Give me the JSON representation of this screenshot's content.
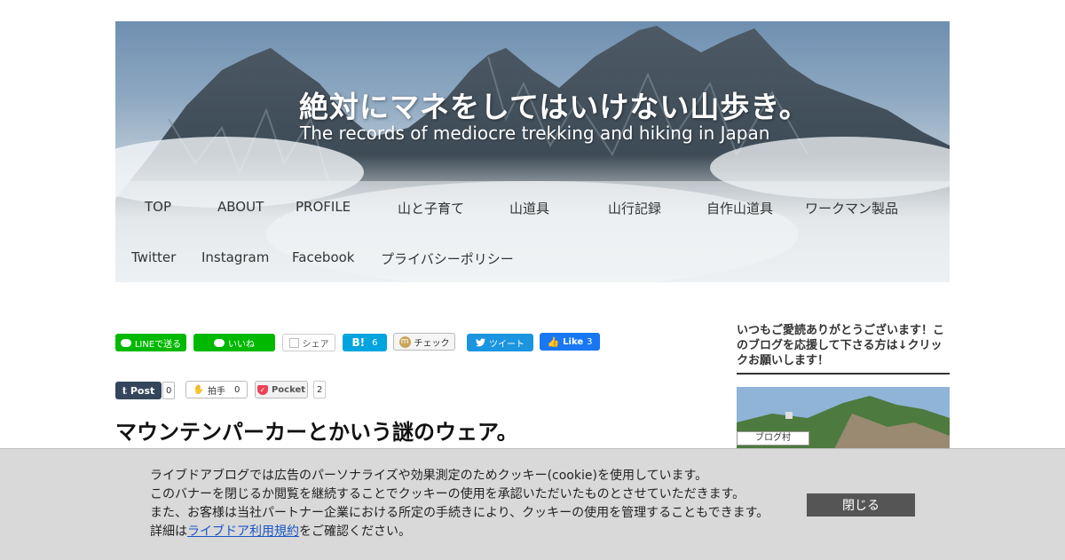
{
  "header": {
    "title": "絶対にマネをしてはいけない山歩き。",
    "subtitle": "The records of mediocre trekking and hiking in Japan"
  },
  "nav": {
    "items": [
      "TOP",
      "ABOUT",
      "PROFILE",
      "山と子育て",
      "山道具",
      "山行記録",
      "自作山道具",
      "ワークマン製品",
      "Twitter",
      "Instagram",
      "Facebook",
      "プライバシーポリシー"
    ]
  },
  "share": {
    "line_send": "LINEで送る",
    "line_like": "いいね",
    "share_label": "シェア",
    "hatena_label": "B!",
    "hatena_count": "6",
    "mixi_check": "チェック",
    "tweet": "ツイート",
    "fb_like": "Like",
    "fb_count": "3",
    "tumblr_post": "Post",
    "tumblr_count": "0",
    "clap": "拍手",
    "clap_count": "0",
    "pocket": "Pocket",
    "pocket_count": "2"
  },
  "post": {
    "title": "マウンテンパーカーとかいう謎のウェア。"
  },
  "sidebar": {
    "heading": "いつもご愛読ありがとうございます！このブログを応援して下さる方は↓クリックお願いします！",
    "badge": "ブログ村"
  },
  "cookie": {
    "line1": "ライブドアブログでは広告のパーソナライズや効果測定のためクッキー(cookie)を使用しています。",
    "line2": "このバナーを閉じるか閲覧を継続することでクッキーの使用を承認いただいたものとさせていただきます。",
    "line3": "また、お客様は当社パートナー企業における所定の手続きにより、クッキーの使用を管理することもできます。",
    "line4_prefix": "詳細は",
    "link": "ライブドア利用規約",
    "line4_suffix": "をご確認ください。",
    "close": "閉じる"
  },
  "colors": {
    "line_green": "#00b900",
    "hatena_blue": "#00a4de",
    "twitter_blue": "#1b95e0",
    "facebook_blue": "#1877f2",
    "tumblr_navy": "#35465c",
    "pocket_red": "#ef4056",
    "cookie_bg": "#d9d9d9",
    "close_button": "#555555"
  }
}
